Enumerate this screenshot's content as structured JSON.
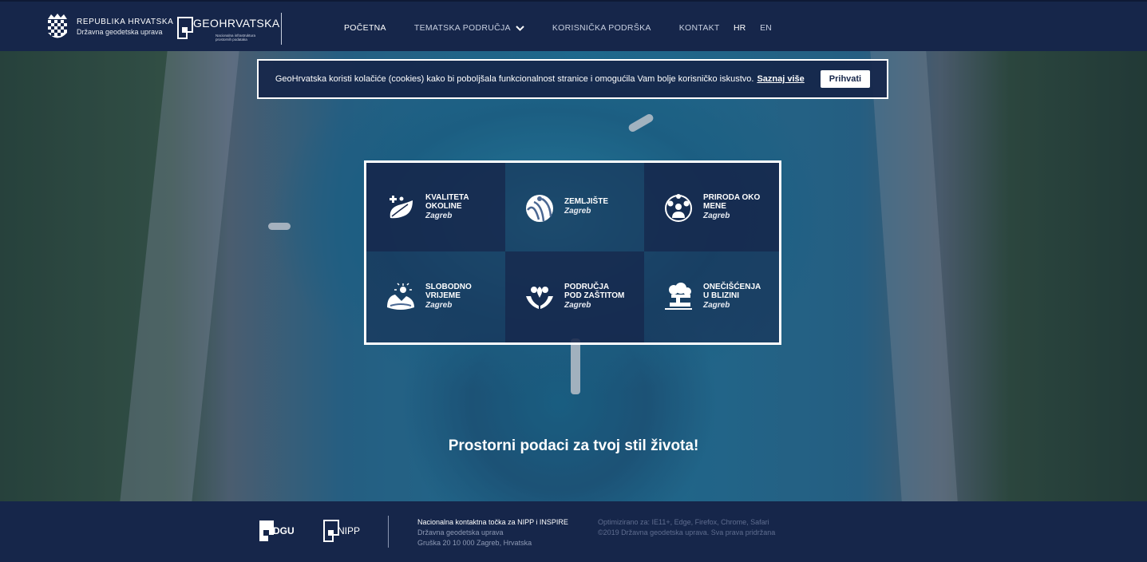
{
  "header": {
    "republic_title": "REPUBLIKA HRVATSKA",
    "republic_sub": "Državna geodetska uprava",
    "geo_name": "GEOHRVATSKA",
    "geo_sub": "Nacionalna infrastruktura prostornih podataka"
  },
  "nav": {
    "items": [
      {
        "label": "POČETNA"
      },
      {
        "label": "TEMATSKA PODRUČJA"
      },
      {
        "label": "KORISNIČKA PODRŠKA"
      },
      {
        "label": "KONTAKT"
      }
    ],
    "languages": [
      "HR",
      "EN"
    ]
  },
  "cookie": {
    "text": "GeoHrvatska koristi kolačiće (cookies) kako bi poboljšala funkcionalnost stranice i omogućila Vam bolje korisničko iskustvo.",
    "link": "Saznaj više",
    "accept": "Prihvati"
  },
  "tiles": [
    {
      "title": "KVALITETA OKOLINE",
      "city": "Zagreb",
      "icon": "quality-icon"
    },
    {
      "title": "ZEMLJIŠTE",
      "city": "Zagreb",
      "icon": "land-icon"
    },
    {
      "title": "PRIRODA OKO MENE",
      "city": "Zagreb",
      "icon": "nature-icon"
    },
    {
      "title": "SLOBODNO VRIJEME",
      "city": "Zagreb",
      "icon": "leisure-icon"
    },
    {
      "title": "PODRUČJA POD ZAŠTITOM",
      "city": "Zagreb",
      "icon": "protected-areas-icon"
    },
    {
      "title": "ONEČIŠĆENJA U BLIZINI",
      "city": "Zagreb",
      "icon": "pollution-icon"
    }
  ],
  "slogan": "Prostorni podaci za tvoj stil života!",
  "footer": {
    "logo1": "DGU",
    "logo2": "NIPP",
    "info_title": "Nacionalna kontaktna točka za NIPP i INSPIRE",
    "info_line1": "Državna geodetska uprava",
    "info_line2": "Gruška 20 10 000 Zagreb, Hrvatska",
    "opt_line1": "Optimizirano za: IE11+, Edge, Firefox, Chrome, Safari",
    "opt_line2": "©2019 Državna geodetska uprava. Sva prava pridržana"
  }
}
